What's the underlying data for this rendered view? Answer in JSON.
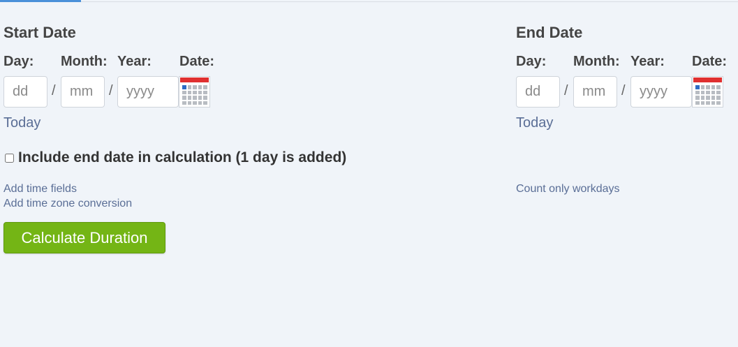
{
  "start": {
    "title": "Start Date",
    "labels": {
      "day": "Day:",
      "month": "Month:",
      "year": "Year:",
      "date": "Date:"
    },
    "placeholders": {
      "day": "dd",
      "month": "mm",
      "year": "yyyy"
    },
    "separator": "/",
    "today_link": "Today"
  },
  "end": {
    "title": "End Date",
    "labels": {
      "day": "Day:",
      "month": "Month:",
      "year": "Year:",
      "date": "Date:"
    },
    "placeholders": {
      "day": "dd",
      "month": "mm",
      "year": "yyyy"
    },
    "separator": "/",
    "today_link": "Today"
  },
  "options": {
    "include_end_date_label": "Include end date in calculation (1 day is added)",
    "include_end_date_checked": false,
    "add_time_fields": "Add time fields",
    "add_time_zone": "Add time zone conversion",
    "count_workdays": "Count only workdays"
  },
  "calculate_button": "Calculate Duration",
  "colors": {
    "accent_tab": "#4a90d9",
    "button_green": "#74b515",
    "link": "#5a6e96",
    "calendar_red": "#e03030"
  },
  "icons": {
    "calendar": "calendar-icon"
  }
}
